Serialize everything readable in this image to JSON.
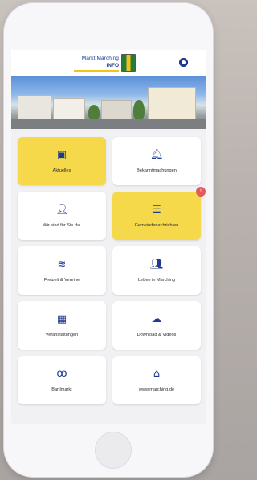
{
  "header": {
    "logo_line1": "Markt Marching",
    "logo_line2": "INFO"
  },
  "tiles": [
    {
      "label": "Aktuelles",
      "icon": "news-icon",
      "active": true
    },
    {
      "label": "Bekanntmachungen",
      "icon": "bell-icon",
      "active": false
    },
    {
      "label": "Wir sind für Sie da!",
      "icon": "person-icon",
      "active": false
    },
    {
      "label": "Gemeindenachrichten",
      "icon": "list-icon",
      "active": true,
      "badge": "!"
    },
    {
      "label": "Freizeit & Vereine",
      "icon": "wifi-icon",
      "active": false
    },
    {
      "label": "Leben in Marching",
      "icon": "people-icon",
      "active": false
    },
    {
      "label": "Veranstaltungen",
      "icon": "calendar-icon",
      "active": false
    },
    {
      "label": "Download & Videos",
      "icon": "cloud-icon",
      "active": false
    },
    {
      "label": "Bartlmarkt",
      "icon": "pretzel-icon",
      "active": false
    },
    {
      "label": "www.marching.de",
      "icon": "home-icon",
      "active": false
    }
  ],
  "colors": {
    "accent_yellow": "#f6d84b",
    "brand_blue": "#1f3a8f",
    "badge_red": "#e15b5b"
  }
}
